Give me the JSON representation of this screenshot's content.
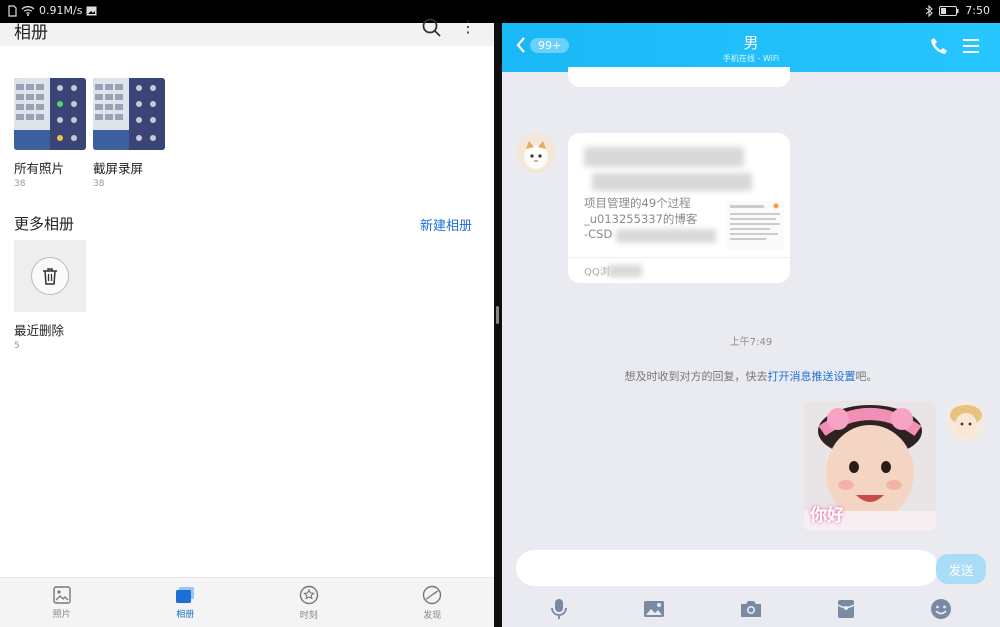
{
  "status_bar": {
    "net_speed": "0.91M/s",
    "time": "7:50"
  },
  "gallery": {
    "title": "相册",
    "albums": [
      {
        "name": "所有照片",
        "count": "38"
      },
      {
        "name": "截屏录屏",
        "count": "38"
      }
    ],
    "more_albums_title": "更多相册",
    "new_album_label": "新建相册",
    "recently_deleted": {
      "name": "最近删除",
      "count": "5"
    },
    "nav": [
      {
        "label": "照片"
      },
      {
        "label": "相册"
      },
      {
        "label": "时刻"
      },
      {
        "label": "发现"
      }
    ]
  },
  "chat": {
    "back_badge": "99+",
    "contact_name": "男",
    "contact_status": "手机在线 - WiFi",
    "card_lines": [
      "项目管理的49个过程",
      "_u013255337的博客",
      "-CSD"
    ],
    "card_footer": "QQ浏",
    "timestamp": "上午7:49",
    "notice_prefix": "想及时收到对方的回复，快去",
    "notice_link": "打开消息推送设置",
    "notice_suffix": "吧。",
    "sticker_text": "你好",
    "input_placeholder": "",
    "send_label": "发送"
  },
  "colors": {
    "accent": "#1d6fd8",
    "chat_header": "#19b8f6"
  }
}
